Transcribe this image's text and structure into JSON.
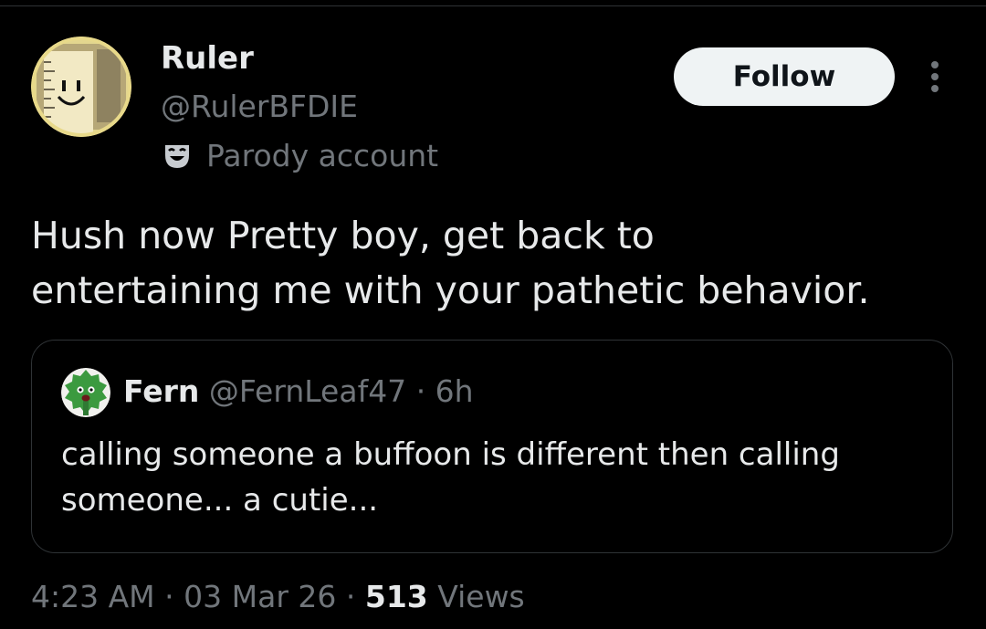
{
  "author": {
    "display_name": "Ruler",
    "handle": "@RulerBFDIE",
    "label": "Parody account",
    "label_icon": "theater-mask-icon",
    "avatar_icon": "ruler-character-avatar"
  },
  "actions": {
    "follow_label": "Follow",
    "more_icon": "more-vertical-icon"
  },
  "tweet": {
    "text": "Hush now Pretty boy, get back to\nentertaining me with your pathetic behavior."
  },
  "quote": {
    "display_name": "Fern",
    "handle": "@FernLeaf47",
    "separator": " · ",
    "age": "6h",
    "text": "calling someone a buffoon is different then calling\nsomeone... a cutie...",
    "avatar_icon": "fern-leaf-avatar"
  },
  "footer": {
    "time": "4:23 AM",
    "sep1": " · ",
    "date": "03 Mar 26",
    "sep2": " · ",
    "views_count": "513",
    "views_label": "Views"
  },
  "colors": {
    "background": "#000000",
    "primary_text": "#e7e9ea",
    "secondary_text": "#71767b",
    "border": "#2f3336",
    "follow_button_bg": "#eff3f4",
    "follow_button_text": "#0f1419"
  }
}
